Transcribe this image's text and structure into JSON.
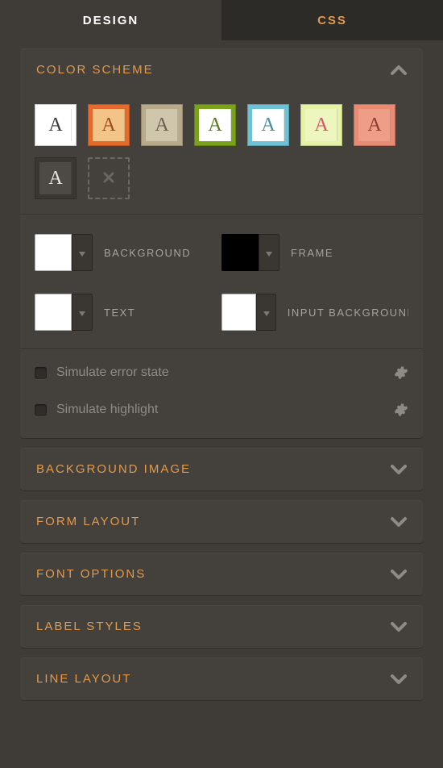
{
  "tabs": {
    "design": "DESIGN",
    "css": "CSS"
  },
  "sections": {
    "color_scheme": {
      "title": "COLOR SCHEME",
      "swatches": [
        {
          "frame": "#ffffff",
          "bg": "#ffffff",
          "letter": "A",
          "letter_color": "#3a3a3a"
        },
        {
          "frame": "#e66a2c",
          "bg": "#f3c487",
          "letter": "A",
          "letter_color": "#a24a1e"
        },
        {
          "frame": "#b7ab8b",
          "bg": "#cfc6ab",
          "letter": "A",
          "letter_color": "#6b644f"
        },
        {
          "frame": "#7aa31b",
          "bg": "#ffffff",
          "letter": "A",
          "letter_color": "#5a7a18"
        },
        {
          "frame": "#6fc2d6",
          "bg": "#ffffff",
          "letter": "A",
          "letter_color": "#4a8fa0"
        },
        {
          "frame": "#e6f2a6",
          "bg": "#eef6bf",
          "letter": "A",
          "letter_color": "#e0526a"
        },
        {
          "frame": "#e98a72",
          "bg": "#ee9d88",
          "letter": "A",
          "letter_color": "#8a3e2e"
        },
        {
          "frame": "#3a3733",
          "bg": "#4d4a45",
          "letter": "A",
          "letter_color": "#e6e3de"
        }
      ],
      "colors": {
        "background": {
          "label": "BACKGROUND",
          "value": "#ffffff"
        },
        "frame": {
          "label": "FRAME",
          "value": "#000000"
        },
        "text": {
          "label": "TEXT",
          "value": "#ffffff"
        },
        "input_bg": {
          "label": "INPUT BACKGROUND",
          "value": "#ffffff"
        }
      },
      "simulate_error": "Simulate error state",
      "simulate_highlight": "Simulate highlight"
    },
    "background_image": {
      "title": "BACKGROUND IMAGE"
    },
    "form_layout": {
      "title": "FORM LAYOUT"
    },
    "font_options": {
      "title": "FONT OPTIONS"
    },
    "label_styles": {
      "title": "LABEL STYLES"
    },
    "line_layout": {
      "title": "LINE LAYOUT"
    }
  }
}
